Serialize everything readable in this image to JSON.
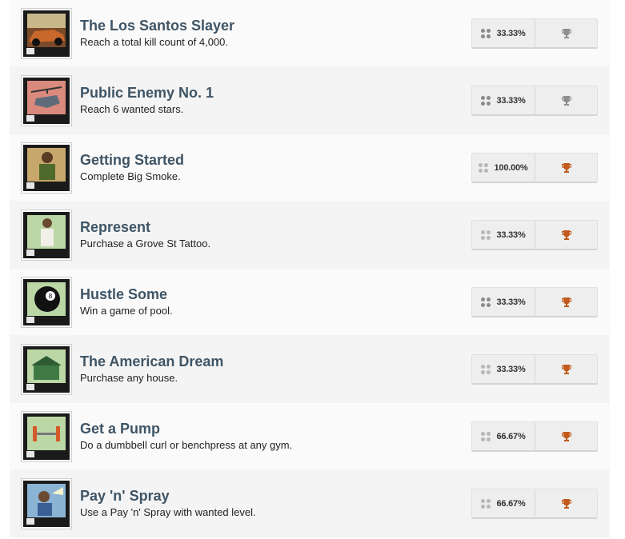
{
  "achievements": [
    {
      "title": "The Los Santos Slayer",
      "description": "Reach a total kill count of 4,000.",
      "rate": "33.33%",
      "trophy_color": "#8f8f8f",
      "dot_color": "dark",
      "icon": "car-icon"
    },
    {
      "title": "Public Enemy No. 1",
      "description": "Reach 6 wanted stars.",
      "rate": "33.33%",
      "trophy_color": "#8f8f8f",
      "dot_color": "dark",
      "icon": "helicopter-icon"
    },
    {
      "title": "Getting Started",
      "description": "Complete Big Smoke.",
      "rate": "100.00%",
      "trophy_color": "#c15a1c",
      "dot_color": "light",
      "icon": "character-icon"
    },
    {
      "title": "Represent",
      "description": "Purchase a Grove St Tattoo.",
      "rate": "33.33%",
      "trophy_color": "#c15a1c",
      "dot_color": "light",
      "icon": "tattoo-icon"
    },
    {
      "title": "Hustle Some",
      "description": "Win a game of pool.",
      "rate": "33.33%",
      "trophy_color": "#c15a1c",
      "dot_color": "dark",
      "icon": "eight-ball-icon"
    },
    {
      "title": "The American Dream",
      "description": "Purchase any house.",
      "rate": "33.33%",
      "trophy_color": "#c15a1c",
      "dot_color": "light",
      "icon": "house-icon"
    },
    {
      "title": "Get a Pump",
      "description": "Do a dumbbell curl or benchpress at any gym.",
      "rate": "66.67%",
      "trophy_color": "#c15a1c",
      "dot_color": "light",
      "icon": "dumbbell-icon"
    },
    {
      "title": "Pay 'n' Spray",
      "description": "Use a Pay 'n' Spray with wanted level.",
      "rate": "66.67%",
      "trophy_color": "#c15a1c",
      "dot_color": "light",
      "icon": "spray-icon"
    }
  ]
}
